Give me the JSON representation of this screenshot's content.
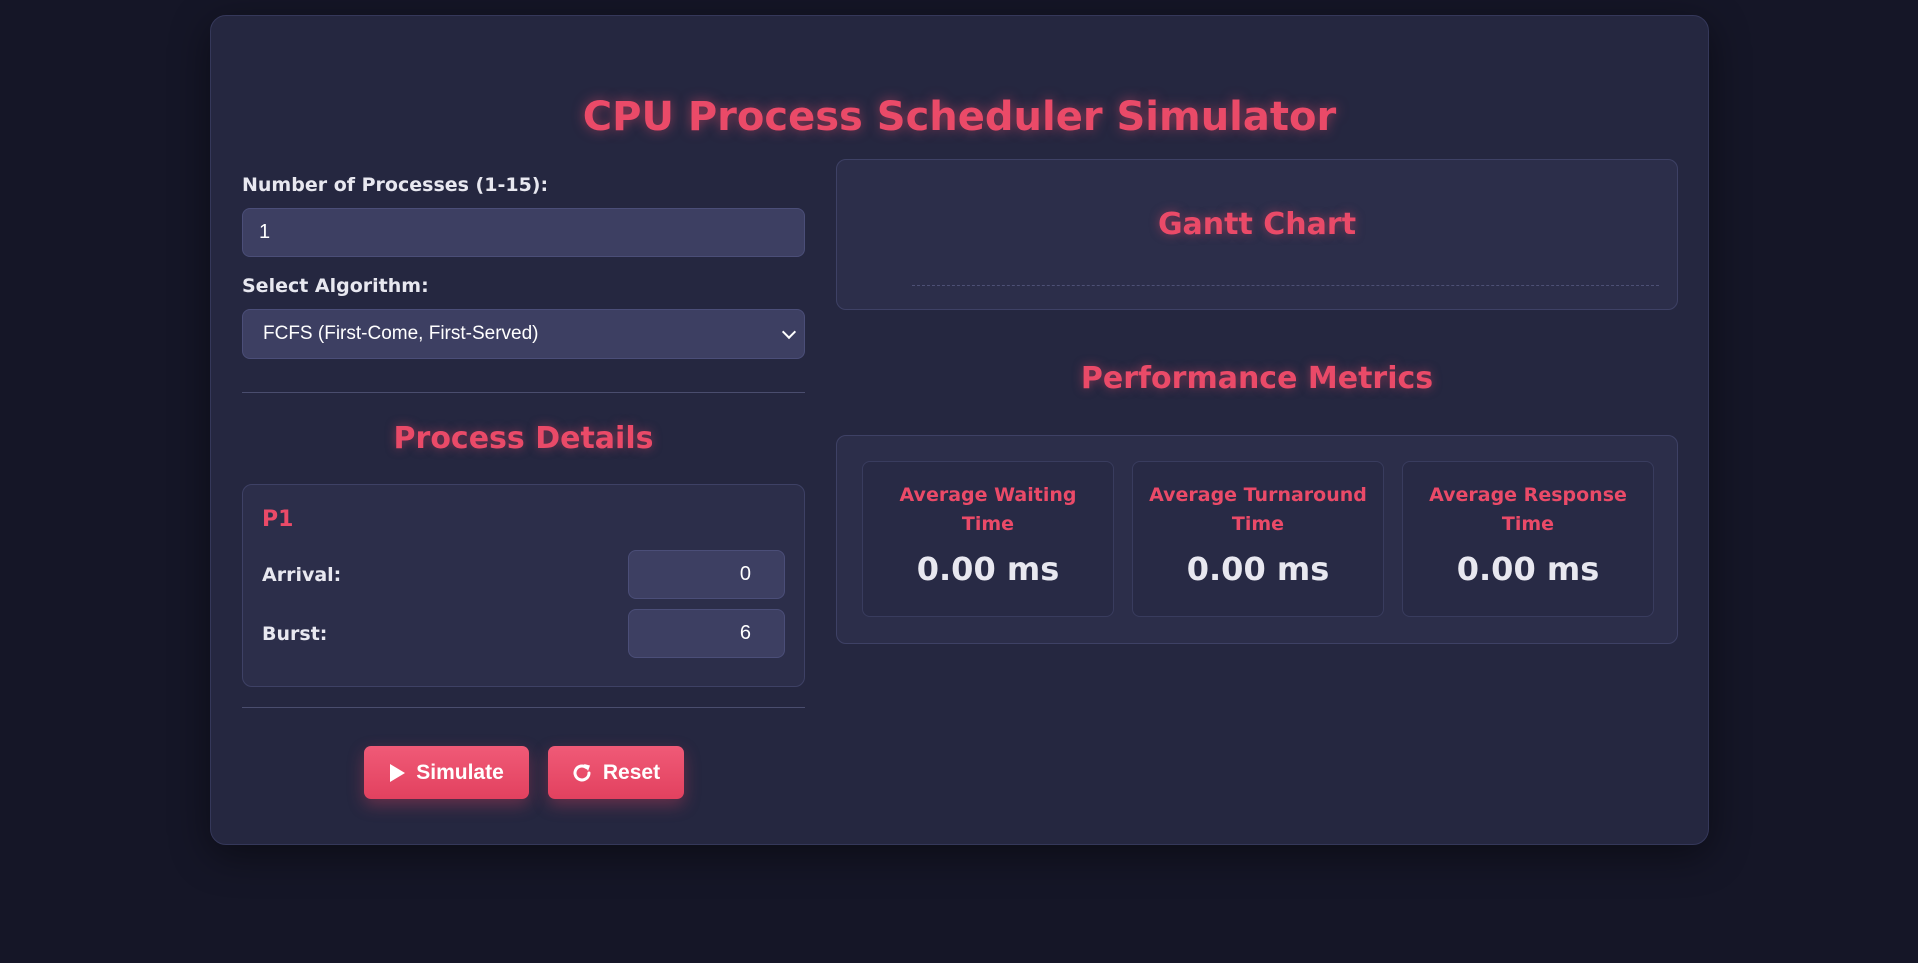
{
  "app": {
    "title": "CPU Process Scheduler Simulator"
  },
  "controls": {
    "num_processes_label": "Number of Processes (1-15):",
    "num_processes_value": "1",
    "algorithm_label": "Select Algorithm:",
    "algorithm_selected": "FCFS (First-Come, First-Served)"
  },
  "process_details": {
    "title": "Process Details",
    "processes": [
      {
        "name": "P1",
        "arrival_label": "Arrival:",
        "arrival_value": "0",
        "burst_label": "Burst:",
        "burst_value": "6"
      }
    ]
  },
  "buttons": {
    "simulate_label": "Simulate",
    "reset_label": "Reset"
  },
  "gantt": {
    "title": "Gantt Chart"
  },
  "metrics": {
    "title": "Performance Metrics",
    "items": [
      {
        "label": "Average Waiting Time",
        "value": "0.00 ms"
      },
      {
        "label": "Average Turnaround Time",
        "value": "0.00 ms"
      },
      {
        "label": "Average Response Time",
        "value": "0.00 ms"
      }
    ]
  },
  "colors": {
    "accent": "#ea4a68",
    "background": "#151627",
    "panel": "#252740",
    "card": "#2c2e4a",
    "input": "#3d3f62"
  },
  "icons": {
    "simulate": "play-icon",
    "reset": "reset-icon",
    "select": "chevron-down-icon"
  }
}
